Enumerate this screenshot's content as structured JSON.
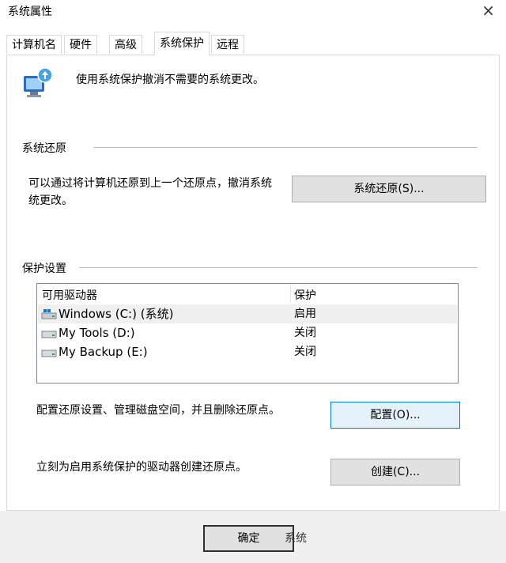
{
  "window": {
    "title": "系统属性",
    "close_glyph": "×"
  },
  "tabs": [
    {
      "label": "计算机名",
      "active": false
    },
    {
      "label": "硬件",
      "active": false
    },
    {
      "label": "高级",
      "active": false
    },
    {
      "label": "系统保护",
      "active": true
    },
    {
      "label": "远程",
      "active": false
    }
  ],
  "header": {
    "icon": "system-protection-shield-icon",
    "text": "使用系统保护撤消不需要的系统更改。"
  },
  "system_restore": {
    "group_label": "系统还原",
    "description_line1": "可以通过将计算机还原到上一个还原点，撤消系统",
    "description_line2": "统更改。",
    "button_label": "系统还原(S)..."
  },
  "protection": {
    "group_label": "保护设置",
    "columns": {
      "drive": "可用驱动器",
      "protection": "保护"
    },
    "drives": [
      {
        "name": "Windows (C:) (系统)",
        "state": "启用",
        "icon": "system-drive-icon",
        "selected": true
      },
      {
        "name": "My Tools (D:)",
        "state": "关闭",
        "icon": "drive-icon",
        "selected": false
      },
      {
        "name": "My Backup (E:)",
        "state": "关闭",
        "icon": "drive-icon",
        "selected": false
      }
    ],
    "configure_text": "配置还原设置、管理磁盘空间，并且删除还原点。",
    "configure_button": "配置(O)...",
    "create_text": "立刻为启用系统保护的驱动器创建还原点。",
    "create_button": "创建(C)..."
  },
  "footer": {
    "ok_label": "确定",
    "partial_label": "系统"
  },
  "colors": {
    "accent_border": "#0078d7",
    "button_face": "#e1e1e1",
    "footer_bg": "#f0f0f0"
  }
}
